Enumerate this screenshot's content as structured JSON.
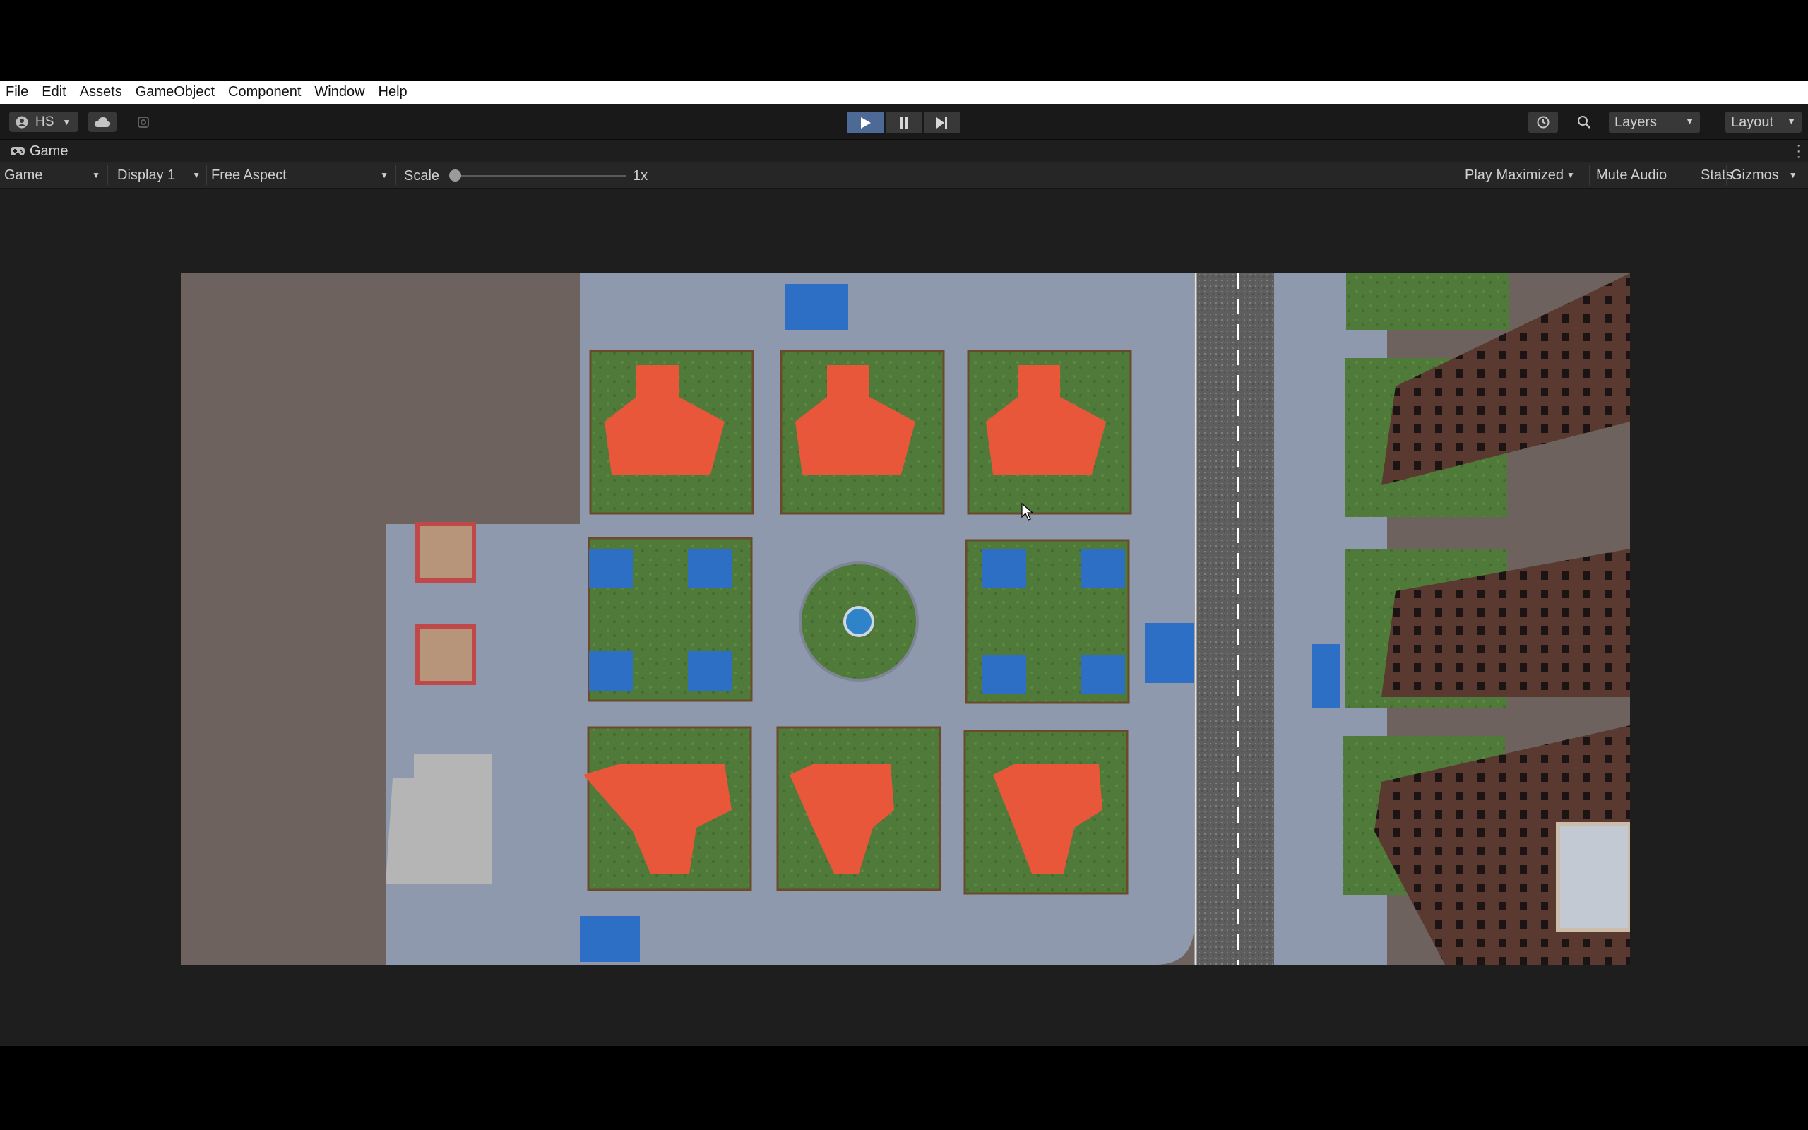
{
  "menu": [
    "File",
    "Edit",
    "Assets",
    "GameObject",
    "Component",
    "Window",
    "Help"
  ],
  "toolbar": {
    "account_label": "HS",
    "layers_label": "Layers",
    "layout_label": "Layout",
    "play_icon": "play-icon",
    "pause_icon": "pause-icon",
    "step_icon": "step-icon",
    "play_active_color": "#4c6a95"
  },
  "tab": {
    "title": "Game",
    "icon": "gamepad-icon"
  },
  "gamebar": {
    "view_mode": "Game",
    "display": "Display 1",
    "aspect": "Free Aspect",
    "scale_label": "Scale",
    "scale_value": "1x",
    "play_maximized": "Play Maximized",
    "mute_audio": "Mute Audio",
    "stats": "Stats",
    "gizmos": "Gizmos"
  },
  "scene": {
    "description_colors": {
      "ground": "#6d625e",
      "pavement": "#8e99ad",
      "grass": "#4f7a39",
      "roof_red": "#e9573a",
      "roof_blue": "#2d6fc4",
      "road": "#6a6a6a",
      "brick": "#5a3a30"
    }
  }
}
